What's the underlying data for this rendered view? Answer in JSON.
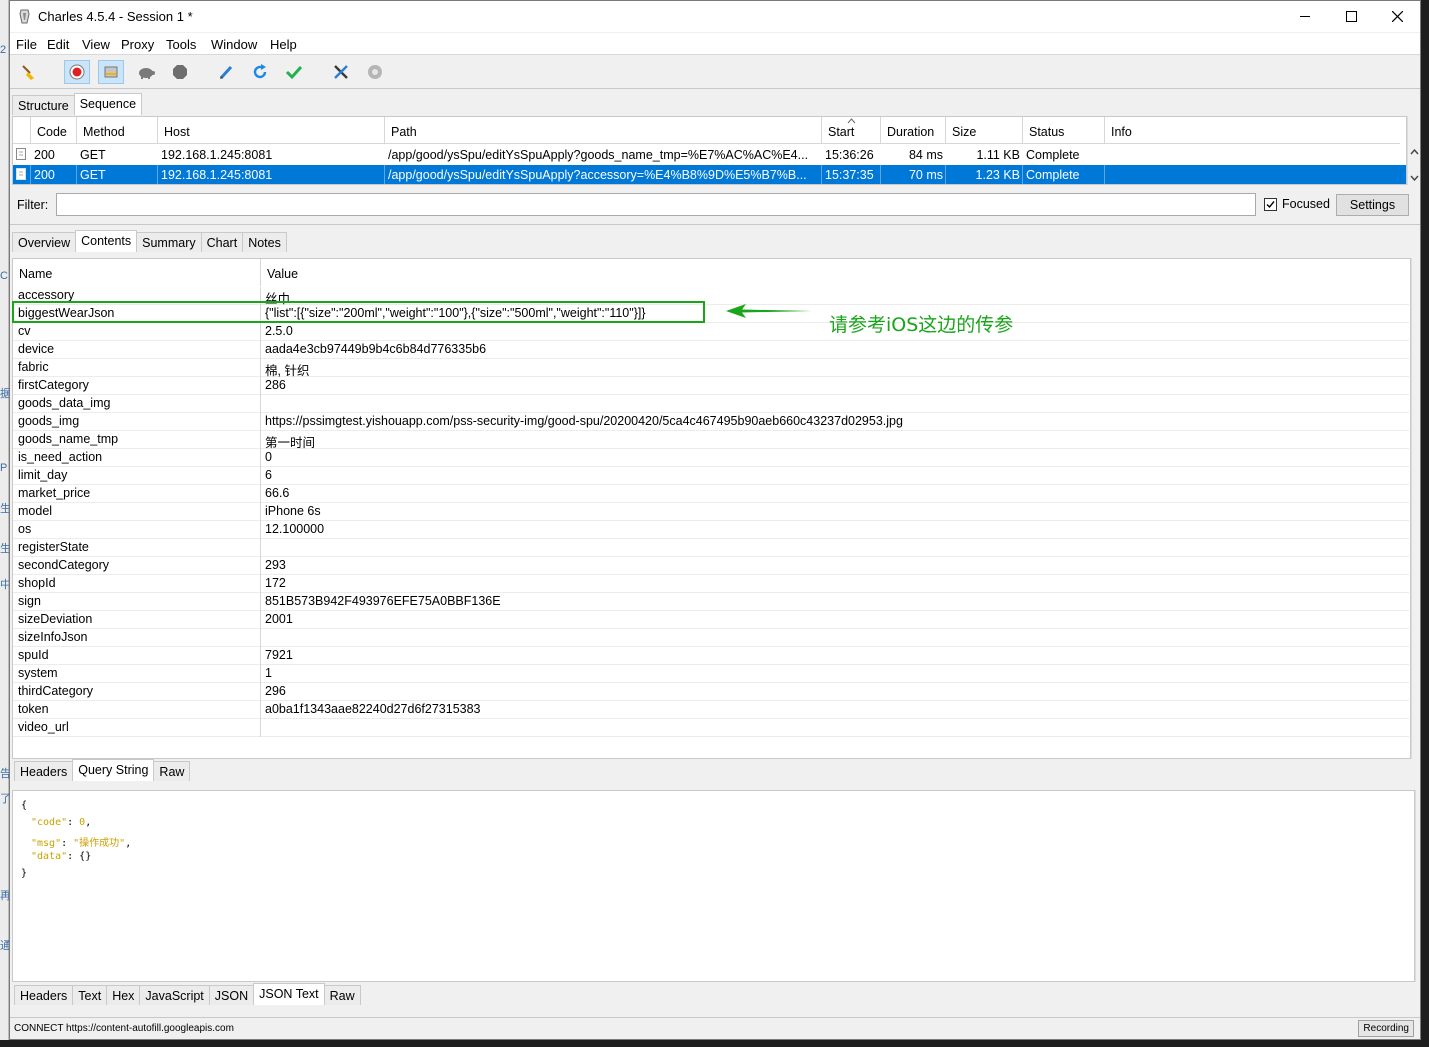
{
  "window": {
    "title": "Charles 4.5.4 - Session 1 *"
  },
  "menu": [
    "File",
    "Edit",
    "View",
    "Proxy",
    "Tools",
    "Window",
    "Help"
  ],
  "top_tabs": [
    "Structure",
    "Sequence"
  ],
  "seq_columns": [
    "Code",
    "Method",
    "Host",
    "Path",
    "Start",
    "Duration",
    "Size",
    "Status",
    "Info"
  ],
  "seq_rows": [
    {
      "code": "200",
      "method": "GET",
      "host": "192.168.1.245:8081",
      "path": "/app/good/ysSpu/editYsSpuApply?goods_name_tmp=%E7%AC%AC%E4...",
      "start": "15:36:26",
      "duration": "84 ms",
      "size": "1.11 KB",
      "status": "Complete",
      "info": ""
    },
    {
      "code": "200",
      "method": "GET",
      "host": "192.168.1.245:8081",
      "path": "/app/good/ysSpu/editYsSpuApply?accessory=%E4%B8%9D%E5%B7%B...",
      "start": "15:37:35",
      "duration": "70 ms",
      "size": "1.23 KB",
      "status": "Complete",
      "info": ""
    }
  ],
  "filter": {
    "label": "Filter:",
    "value": "",
    "focused_label": "Focused",
    "settings_label": "Settings"
  },
  "detail_tabs": [
    "Overview",
    "Contents",
    "Summary",
    "Chart",
    "Notes"
  ],
  "nv_columns": [
    "Name",
    "Value"
  ],
  "params": [
    {
      "name": "accessory",
      "value": "丝巾"
    },
    {
      "name": "biggestWearJson",
      "value": "{\"list\":[{\"size\":\"200ml\",\"weight\":\"100\"},{\"size\":\"500ml\",\"weight\":\"110\"}]}"
    },
    {
      "name": "cv",
      "value": "2.5.0"
    },
    {
      "name": "device",
      "value": "aada4e3cb97449b9b4c6b84d776335b6"
    },
    {
      "name": "fabric",
      "value": "棉, 针织"
    },
    {
      "name": "firstCategory",
      "value": "286"
    },
    {
      "name": "goods_data_img",
      "value": ""
    },
    {
      "name": "goods_img",
      "value": "https://pssimgtest.yishouapp.com/pss-security-img/good-spu/20200420/5ca4c467495b90aeb660c43237d02953.jpg"
    },
    {
      "name": "goods_name_tmp",
      "value": "第一时间"
    },
    {
      "name": "is_need_action",
      "value": "0"
    },
    {
      "name": "limit_day",
      "value": "6"
    },
    {
      "name": "market_price",
      "value": "66.6"
    },
    {
      "name": "model",
      "value": "iPhone 6s"
    },
    {
      "name": "os",
      "value": "12.100000"
    },
    {
      "name": "registerState",
      "value": ""
    },
    {
      "name": "secondCategory",
      "value": "293"
    },
    {
      "name": "shopId",
      "value": "172"
    },
    {
      "name": "sign",
      "value": "851B573B942F493976EFE75A0BBF136E"
    },
    {
      "name": "sizeDeviation",
      "value": "2001"
    },
    {
      "name": "sizeInfoJson",
      "value": ""
    },
    {
      "name": "spuId",
      "value": "7921"
    },
    {
      "name": "system",
      "value": "1"
    },
    {
      "name": "thirdCategory",
      "value": "296"
    },
    {
      "name": "token",
      "value": "a0ba1f1343aae82240d27d6f27315383"
    },
    {
      "name": "video_url",
      "value": ""
    }
  ],
  "annotation": "请参考iOS这边的传参",
  "request_tabs": [
    "Headers",
    "Query String",
    "Raw"
  ],
  "response_json": {
    "open": "{",
    "code_key": "\"code\"",
    "code_val": "0",
    "msg_key": "\"msg\"",
    "msg_val": "\"操作成功\"",
    "data_key": "\"data\"",
    "data_val": "{}",
    "close": "}"
  },
  "response_tabs": [
    "Headers",
    "Text",
    "Hex",
    "JavaScript",
    "JSON",
    "JSON Text",
    "Raw"
  ],
  "status": {
    "text": "CONNECT https://content-autofill.googleapis.com",
    "recording": "Recording"
  },
  "colors": {
    "selection": "#0078d7",
    "annotation": "#1aa51a"
  }
}
